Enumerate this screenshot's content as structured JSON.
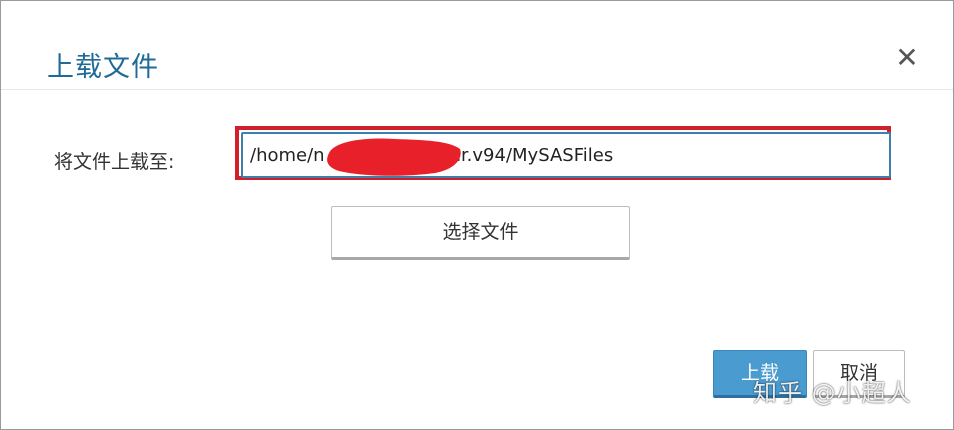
{
  "dialog": {
    "title": "上载文件",
    "close_icon": "close-icon",
    "close_glyph": "✕"
  },
  "form": {
    "label": "将文件上载至:",
    "path_value": "/home/n            /sasuser.v94/MySASFiles",
    "redaction_color": "#e8202a",
    "highlight_color": "#d0202a",
    "choose_file_label": "选择文件"
  },
  "footer": {
    "upload_label": "上载",
    "cancel_label": "取消"
  },
  "watermark": {
    "text": "知乎 @小超人"
  },
  "colors": {
    "title": "#1f6a97",
    "primary_button": "#4a9bd0",
    "input_border": "#3d7fad"
  }
}
